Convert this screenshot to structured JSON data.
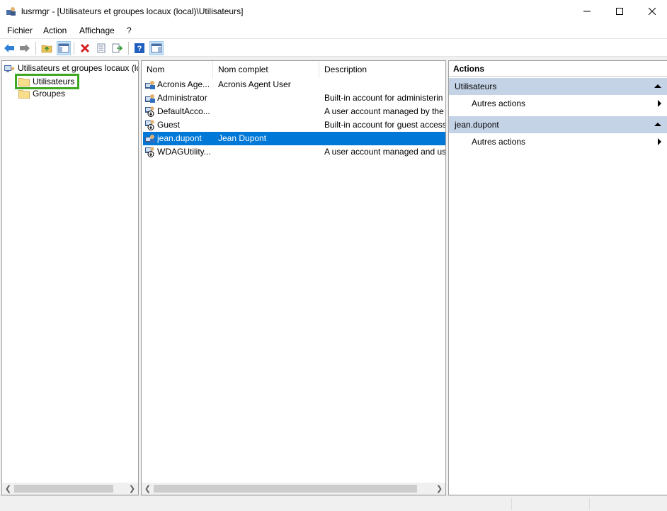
{
  "window": {
    "title": "lusrmgr - [Utilisateurs et groupes locaux (local)\\Utilisateurs]"
  },
  "menu": [
    "Fichier",
    "Action",
    "Affichage",
    "?"
  ],
  "toolbar": {
    "icons": [
      "back-icon",
      "forward-icon",
      "up-folder-icon",
      "show-hide-tree-icon",
      "delete-icon",
      "properties-icon",
      "export-list-icon",
      "help-icon",
      "show-hide-action-pane-icon"
    ]
  },
  "tree": {
    "root": "Utilisateurs et groupes locaux (lo",
    "users": "Utilisateurs",
    "groups": "Groupes"
  },
  "list": {
    "columns": [
      "Nom",
      "Nom complet",
      "Description"
    ],
    "rows": [
      {
        "name": "Acronis Age...",
        "fullname": "Acronis Agent User",
        "description": "",
        "icon": "user-icon"
      },
      {
        "name": "Administrator",
        "fullname": "",
        "description": "Built-in account for administerin",
        "icon": "user-icon"
      },
      {
        "name": "DefaultAcco...",
        "fullname": "",
        "description": "A user account managed by the",
        "icon": "disabled-user-icon"
      },
      {
        "name": "Guest",
        "fullname": "",
        "description": "Built-in account for guest access",
        "icon": "disabled-user-icon"
      },
      {
        "name": "jean.dupont",
        "fullname": "Jean Dupont",
        "description": "",
        "icon": "user-icon",
        "selected": true
      },
      {
        "name": "WDAGUtility...",
        "fullname": "",
        "description": "A user account managed and us",
        "icon": "disabled-user-icon"
      }
    ]
  },
  "actions": {
    "title": "Actions",
    "groups": [
      {
        "header": "Utilisateurs",
        "items": [
          "Autres actions"
        ]
      },
      {
        "header": "jean.dupont",
        "items": [
          "Autres actions"
        ]
      }
    ]
  },
  "colors": {
    "selection": "#0078d7",
    "highlight_border": "#3fa822",
    "action_header": "#c5d3e6"
  }
}
